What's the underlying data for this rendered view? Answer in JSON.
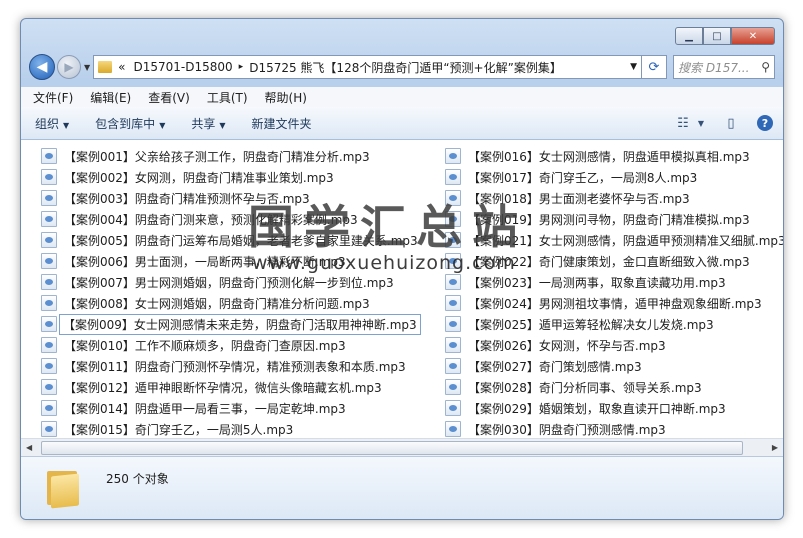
{
  "window": {
    "controls": {
      "minimize": "▁",
      "maximize": "□",
      "close": "✕"
    }
  },
  "address": {
    "overflow": "«",
    "crumbs": [
      "D15701-D15800",
      "D15725 熊飞【128个阴盘奇门遁甲“预测+化解”案例集】"
    ],
    "separator": "▸",
    "dropdown": "▼",
    "refresh_icon": "refresh-icon"
  },
  "search": {
    "placeholder": "搜索 D157...",
    "icon": "search-icon"
  },
  "menu": [
    "文件(F)",
    "编辑(E)",
    "查看(V)",
    "工具(T)",
    "帮助(H)"
  ],
  "toolbar": {
    "organize": "组织",
    "include_library": "包含到库中",
    "share": "共享",
    "new_folder": "新建文件夹",
    "dd": "▼",
    "help": "?"
  },
  "files_left": [
    "【案例001】父亲给孩子测工作，阴盘奇门精准分析.mp3",
    "【案例002】女网测，阴盘奇门精准事业策划.mp3",
    "【案例003】阴盘奇门精准预测怀孕与否.mp3",
    "【案例004】阴盘奇门测来意，预测化解精彩案例.mp3",
    "【案例005】阴盘奇门运筹布局婚姻，老者老爹自家里建关系.mp3",
    "【案例006】男士面测，一局断两事，精彩不断.mp3",
    "【案例007】男士网测婚姻，阴盘奇门预测化解一步到位.mp3",
    "【案例008】女士网测婚姻，阴盘奇门精准分析问题.mp3",
    "【案例009】女士网测感情未来走势，阴盘奇门活取用神神断.mp3",
    "【案例010】工作不顺麻烦多，阴盘奇门查原因.mp3",
    "【案例011】阴盘奇门预测怀孕情况，精准预测表象和本质.mp3",
    "【案例012】遁甲神眼断怀孕情况，微信头像暗藏玄机.mp3",
    "【案例014】阴盘遁甲一局看三事，一局定乾坤.mp3",
    "【案例015】奇门穿壬乙，一局测5人.mp3"
  ],
  "files_right": [
    "【案例016】女士网测感情，阴盘遁甲模拟真相.mp3",
    "【案例017】奇门穿壬乙，一局测8人.mp3",
    "【案例018】男士面测老婆怀孕与否.mp3",
    "【案例019】男网测问寻物，阴盘奇门精准模拟.mp3",
    "【案例021】女士网测感情，阴盘遁甲预测精准又细腻.mp3",
    "【案例022】奇门健康策划，金口直断细致入微.mp3",
    "【案例023】一局测两事，取象直读藏功用.mp3",
    "【案例024】男网测祖坟事情，遁甲神盘观象细断.mp3",
    "【案例025】遁甲运筹轻松解决女儿发烧.mp3",
    "【案例026】女网测，怀孕与否.mp3",
    "【案例027】奇门策划感情.mp3",
    "【案例028】奇门分析同事、领导关系.mp3",
    "【案例029】婚姻策划，取象直读开口神断.mp3",
    "【案例030】阴盘奇门预测感情.mp3"
  ],
  "status": {
    "count": "250 个对象"
  },
  "watermark": {
    "line1": "国学汇总站",
    "line2": "www.guoxuehuizong.com"
  }
}
